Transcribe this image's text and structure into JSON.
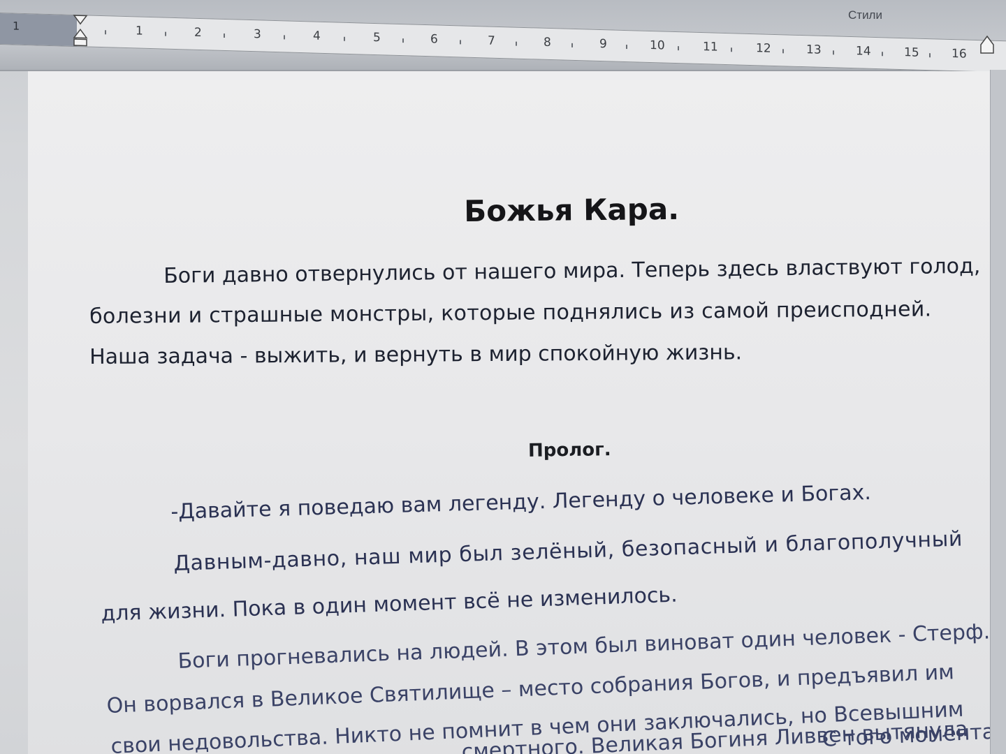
{
  "ruler": {
    "margin_number": "1",
    "ticks": [
      "1",
      "2",
      "3",
      "4",
      "5",
      "6",
      "7",
      "8",
      "9",
      "10",
      "11",
      "12",
      "13",
      "14",
      "15",
      "16"
    ],
    "styles_label": "Стили"
  },
  "document": {
    "title": "Божья Кара.",
    "intro_lines": [
      "Боги давно отвернулись от нашего мира. Теперь здесь властвуют голод,",
      "болезни  и  страшные  монстры,  которые  поднялись  из  самой  преисподней.",
      "Наша задача - выжить, и вернуть в мир спокойную жизнь."
    ],
    "section_heading": "Пролог.",
    "prologue_lines": [
      "-Давайте я поведаю вам легенду. Легенду о человеке и Богах.",
      "Давным-давно,  наш  мир  был  зелёный,  безопасный  и  благополучный",
      "для жизни. Пока в один момент всё не изменилось.",
      "Боги прогневались на людей. В этом был виноват один человек - Стерф.",
      "Он ворвался в Великое Святилище – место собрания Богов, и предъявил им",
      "свои недовольства. Никто не помнит в чем они заключались, но Всевышним",
      "смертного.  Великая  Богиня  Ливвен  вытянула",
      "С того момента"
    ]
  }
}
